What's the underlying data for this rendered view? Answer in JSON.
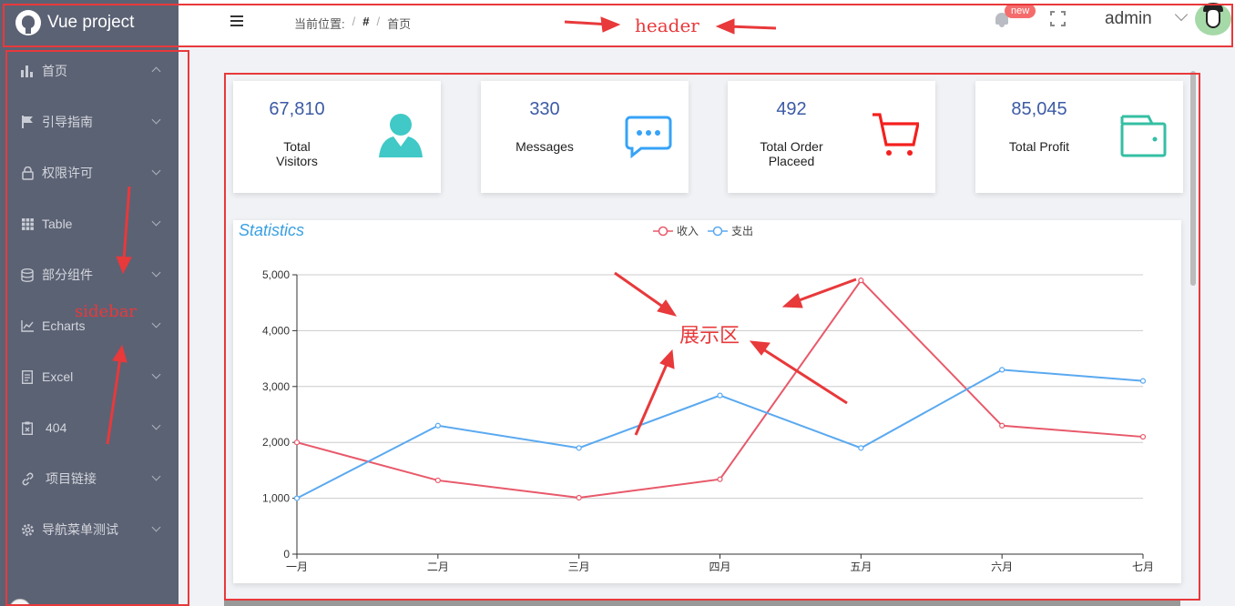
{
  "app": {
    "title": "Vue project"
  },
  "sidebar": {
    "items": [
      {
        "label": "首页",
        "icon": "bar-chart-icon",
        "expanded": true
      },
      {
        "label": "引导指南",
        "icon": "flag-icon"
      },
      {
        "label": "权限许可",
        "icon": "lock-icon"
      },
      {
        "label": "Table",
        "icon": "grid-icon"
      },
      {
        "label": "部分组件",
        "icon": "database-icon"
      },
      {
        "label": "Echarts",
        "icon": "line-chart-icon"
      },
      {
        "label": "Excel",
        "icon": "document-icon"
      },
      {
        "label": "404",
        "icon": "clipboard-x-icon"
      },
      {
        "label": "项目链接",
        "icon": "link-icon"
      },
      {
        "label": "导航菜单测试",
        "icon": "gear-icon"
      }
    ]
  },
  "header": {
    "breadcrumb_label": "当前位置:",
    "breadcrumb_sep": "/",
    "breadcrumb_home": "#",
    "breadcrumb_current": "首页",
    "badge": "new",
    "username": "admin"
  },
  "cards": [
    {
      "value": "67,810",
      "label": "Total\nVisitors",
      "icon": "user-icon",
      "color": "#40c9c6"
    },
    {
      "value": "330",
      "label": "Messages",
      "icon": "message-icon",
      "color": "#36a3f7"
    },
    {
      "value": "492",
      "label": "Total Order\nPlaceed",
      "icon": "shopping-cart-icon",
      "color": "#f4201e"
    },
    {
      "value": "85,045",
      "label": "Total Profit",
      "icon": "wallet-icon",
      "color": "#34bfa3"
    }
  ],
  "chart_data": {
    "type": "line",
    "title": "Statistics",
    "categories": [
      "一月",
      "二月",
      "三月",
      "四月",
      "五月",
      "六月",
      "七月"
    ],
    "series": [
      {
        "name": "收入",
        "color": "#e8596a",
        "values": [
          2000,
          1320,
          1010,
          1340,
          4900,
          2300,
          2100
        ]
      },
      {
        "name": "支出",
        "color": "#5aa9f0",
        "values": [
          1000,
          2300,
          1900,
          2840,
          1900,
          3300,
          3100
        ]
      }
    ],
    "y_ticks": [
      "0",
      "1,000",
      "2,000",
      "3,000",
      "4,000",
      "5,000"
    ],
    "ylim": [
      0,
      5000
    ],
    "grid": true,
    "legend": "top-center"
  },
  "annotations": {
    "header": "header",
    "sidebar": "sidebar",
    "content": "展示区",
    "color": "#e8393b"
  }
}
